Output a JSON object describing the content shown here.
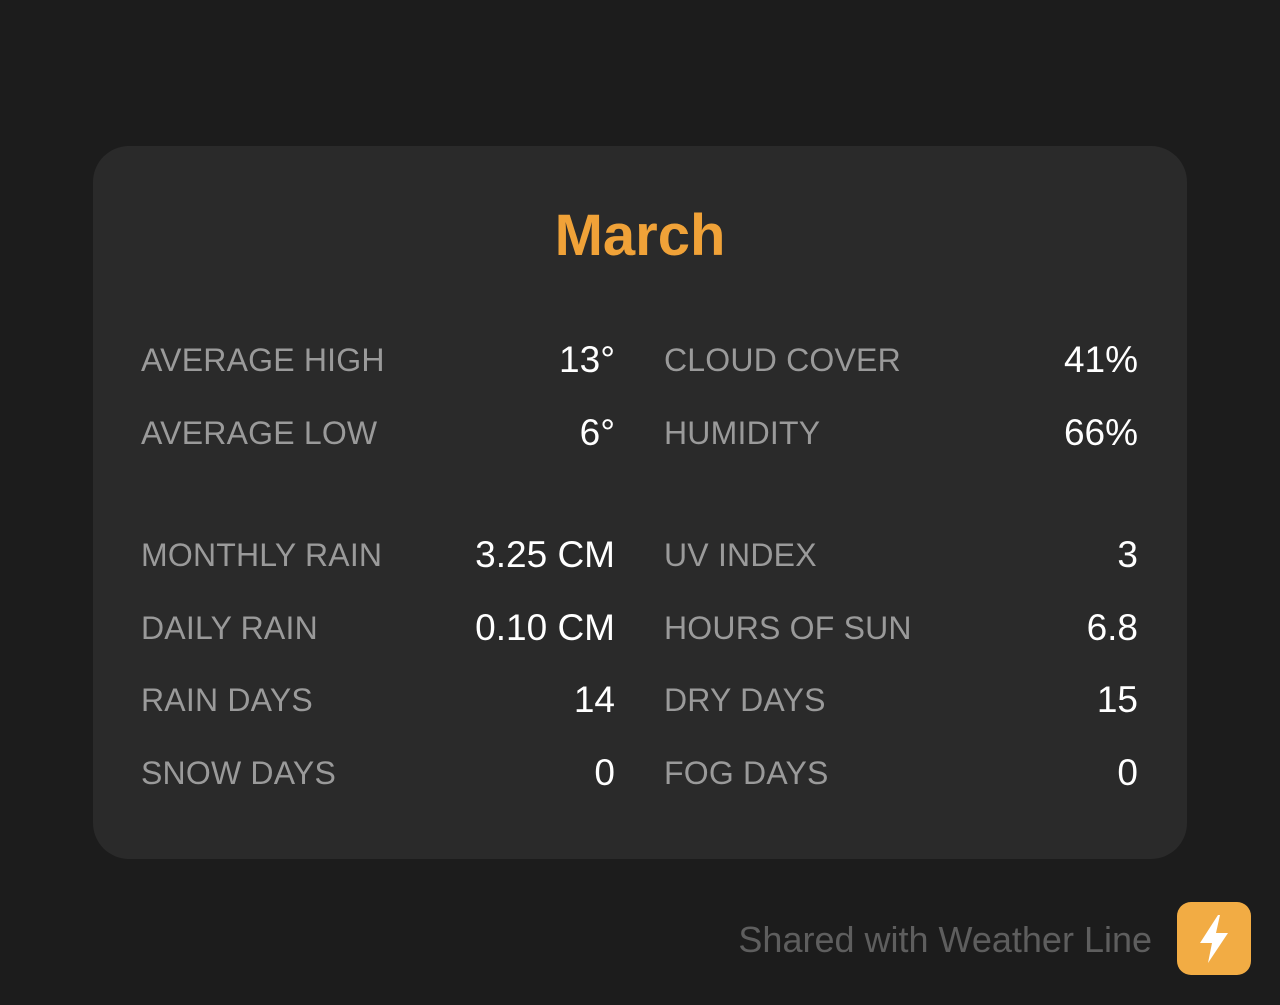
{
  "card": {
    "title": "March",
    "stats": [
      {
        "label": "AVERAGE HIGH",
        "value": "13°"
      },
      {
        "label": "CLOUD COVER",
        "value": "41%"
      },
      {
        "label": "AVERAGE LOW",
        "value": "6°"
      },
      {
        "label": "HUMIDITY",
        "value": "66%"
      },
      {
        "label": "MONTHLY RAIN",
        "value": "3.25 CM"
      },
      {
        "label": "UV INDEX",
        "value": "3"
      },
      {
        "label": "DAILY RAIN",
        "value": "0.10 CM"
      },
      {
        "label": "HOURS OF SUN",
        "value": "6.8"
      },
      {
        "label": "RAIN DAYS",
        "value": "14"
      },
      {
        "label": "DRY DAYS",
        "value": "15"
      },
      {
        "label": "SNOW DAYS",
        "value": "0"
      },
      {
        "label": "FOG DAYS",
        "value": "0"
      }
    ]
  },
  "footer": {
    "text": "Shared with Weather Line",
    "icon": "lightning-bolt-icon"
  },
  "colors": {
    "background": "#1c1c1c",
    "card": "#2a2a2a",
    "accent": "#f0a238",
    "label": "#9a9a9a",
    "value": "#ffffff"
  }
}
